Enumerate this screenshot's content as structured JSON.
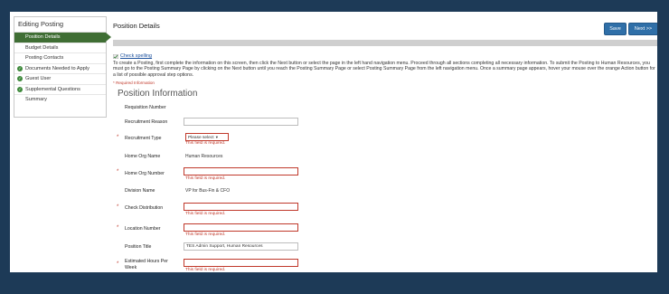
{
  "sidebar": {
    "title": "Editing Posting",
    "items": [
      {
        "label": "Position Details",
        "active": true,
        "checked": false
      },
      {
        "label": "Budget Details",
        "active": false,
        "checked": false
      },
      {
        "label": "Posting Contacts",
        "active": false,
        "checked": false
      },
      {
        "label": "Documents Needed to Apply",
        "active": false,
        "checked": true
      },
      {
        "label": "Guest User",
        "active": false,
        "checked": true
      },
      {
        "label": "Supplemental Questions",
        "active": false,
        "checked": true
      },
      {
        "label": "Summary",
        "active": false,
        "checked": false
      }
    ]
  },
  "header": {
    "title": "Position Details",
    "save_label": "Save",
    "next_label": "Next >>"
  },
  "spell_check_label": "Check spelling",
  "instructions": "To create a Posting, first complete the information on this screen, then click the Next button or select the page in the left hand navigation menu. Proceed through all sections completing all necessary information. To submit the Posting to Human Resources, you must go to the Posting Summary Page by clicking on the Next button until you reach the Posting Summary Page or select Posting Summary Page from the left navigation menu. Once a summary page appears, hover your mouse over the orange Action button for a list of possible approval step options.",
  "required_note": "* Required Information",
  "section_title": "Position Information",
  "error_text": "This field is required.",
  "fields": {
    "requisition_number": {
      "label": "Requisition Number"
    },
    "recruitment_reason": {
      "label": "Recruitment Reason",
      "value": ""
    },
    "recruitment_type": {
      "label": "Recruitment Type",
      "value": "Please select"
    },
    "home_org_name": {
      "label": "Home Org Name",
      "value": "Human Resources"
    },
    "home_org_number": {
      "label": "Home Org Number",
      "value": ""
    },
    "division_name": {
      "label": "Division Name",
      "value": "VP for Bus-Fin & CFO"
    },
    "check_distribution": {
      "label": "Check Distribution",
      "value": ""
    },
    "location_number": {
      "label": "Location Number",
      "value": ""
    },
    "position_title": {
      "label": "Position Title",
      "value": "TES Admin Support, Human Resources"
    },
    "estimated_hours": {
      "label": "Estimated Hours Per Week",
      "value": ""
    }
  },
  "colors": {
    "background": "#1d3a57",
    "active_nav": "#3f6e34",
    "button": "#2f6fa8",
    "error": "#c0392b"
  }
}
